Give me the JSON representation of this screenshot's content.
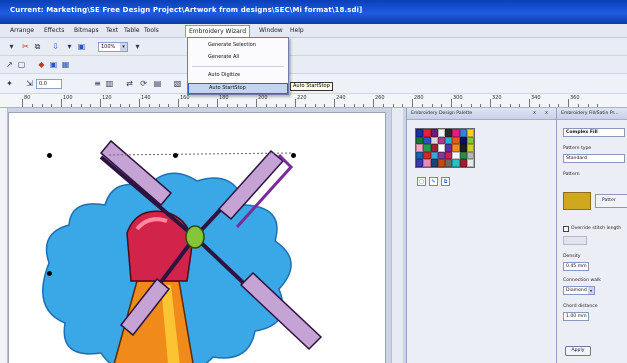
{
  "titlebar": {
    "title": "Current: Marketing\\SE Free Design Project\\Artwork from designs\\SEC\\Mi format\\18.sdi]"
  },
  "menubar": {
    "items": [
      "Arrange",
      "Effects",
      "Bitmaps",
      "Text",
      "Table",
      "Tools",
      "Embroidery Wizard",
      "Window",
      "Help"
    ]
  },
  "toolbar": {
    "zoom": "100%",
    "position": "0.0"
  },
  "dropdown": {
    "items": [
      "Generate Selection",
      "Generate All",
      "Auto Digitize",
      "Auto StartStop"
    ],
    "highlighted": "Auto StartStop",
    "tooltip": "Auto StartStop"
  },
  "ruler": {
    "labels": [
      "80",
      "100",
      "120",
      "140",
      "160",
      "180",
      "200",
      "220",
      "240",
      "260",
      "280",
      "300",
      "320",
      "340",
      "360"
    ]
  },
  "palette_panel": {
    "title": "Embroidery Design Palette",
    "controls": [
      "x",
      "x"
    ],
    "colors": [
      "#1b2fa8",
      "#e0233a",
      "#6a1f7a",
      "#f2f2f2",
      "#2a2a2a",
      "#e01f83",
      "#3e7fd4",
      "#f5d12a",
      "#0a7f3a",
      "#2a53c2",
      "#d8d8d8",
      "#b03a8b",
      "#20b3d6",
      "#e15d1d",
      "#0e0e5e",
      "#86c43a",
      "#f0a6c4",
      "#2b9a50",
      "#9c2333",
      "#ffffff",
      "#5d32a8",
      "#f08a1a",
      "#1d1d1d",
      "#c9d12a",
      "#1e5fb5",
      "#cc2b2b",
      "#39a7d9",
      "#7d3d9b",
      "#d11e5a",
      "#fafafa",
      "#2f8c47",
      "#b5b5b5",
      "#3a3ab8",
      "#e88ab5",
      "#17467a",
      "#c44a1a",
      "#6a6a6a",
      "#28c0c8",
      "#a01e32",
      "#e8e8e8"
    ]
  },
  "fill_panel": {
    "title": "Embroidery Fill/Satin Pr...",
    "complex_fill": "Complex Fill",
    "pattern_type_label": "Pattern type",
    "pattern_type_value": "Standard",
    "pattern_label": "Pattern",
    "pattern_button": "Patter",
    "override_label": "Override stitch length",
    "density_label": "Density",
    "density_value": "0.45 mm",
    "connection_label": "Connection walk",
    "connection_value": "Diamond",
    "chord_label": "Chord distance",
    "chord_value": "1.00 mm",
    "apply": "Apply"
  },
  "colors": {
    "sky": "#3aa7e6",
    "blade_fill": "#c5a3d4",
    "tower": "#f08a1a",
    "cap": "#d2244b",
    "hub": "#86c43a"
  }
}
